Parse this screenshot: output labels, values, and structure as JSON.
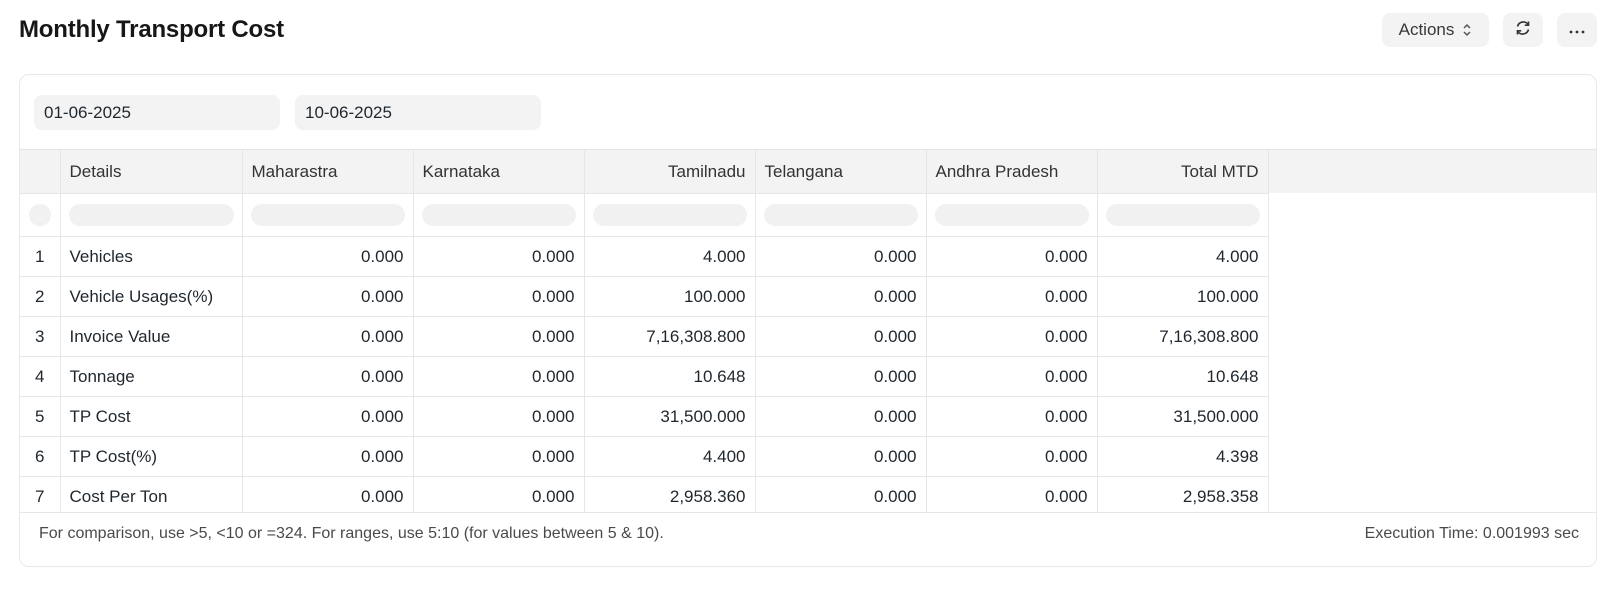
{
  "page": {
    "title": "Monthly Transport Cost",
    "actions_label": "Actions",
    "refresh_icon": "refresh-icon",
    "more_icon": "more-horizontal-icon"
  },
  "filters": {
    "from_date": "01-06-2025",
    "to_date": "10-06-2025"
  },
  "table": {
    "columns": [
      "Details",
      "Maharastra",
      "Karnataka",
      "Tamilnadu",
      "Telangana",
      "Andhra Pradesh",
      "Total MTD"
    ],
    "rows": [
      {
        "no": "1",
        "cells": [
          "Vehicles",
          "0.000",
          "0.000",
          "4.000",
          "0.000",
          "0.000",
          "4.000"
        ]
      },
      {
        "no": "2",
        "cells": [
          "Vehicle Usages(%)",
          "0.000",
          "0.000",
          "100.000",
          "0.000",
          "0.000",
          "100.000"
        ]
      },
      {
        "no": "3",
        "cells": [
          "Invoice Value",
          "0.000",
          "0.000",
          "7,16,308.800",
          "0.000",
          "0.000",
          "7,16,308.800"
        ]
      },
      {
        "no": "4",
        "cells": [
          "Tonnage",
          "0.000",
          "0.000",
          "10.648",
          "0.000",
          "0.000",
          "10.648"
        ]
      },
      {
        "no": "5",
        "cells": [
          "TP Cost",
          "0.000",
          "0.000",
          "31,500.000",
          "0.000",
          "0.000",
          "31,500.000"
        ]
      },
      {
        "no": "6",
        "cells": [
          "TP Cost(%)",
          "0.000",
          "0.000",
          "4.400",
          "0.000",
          "0.000",
          "4.398"
        ]
      },
      {
        "no": "7",
        "cells": [
          "Cost Per Ton",
          "0.000",
          "0.000",
          "2,958.360",
          "0.000",
          "0.000",
          "2,958.358"
        ]
      }
    ]
  },
  "footer": {
    "note": "For comparison, use >5, <10 or =324. For ranges, use 5:10 (for values between 5 & 10).",
    "execution_time": "Execution Time: 0.001993 sec"
  }
}
